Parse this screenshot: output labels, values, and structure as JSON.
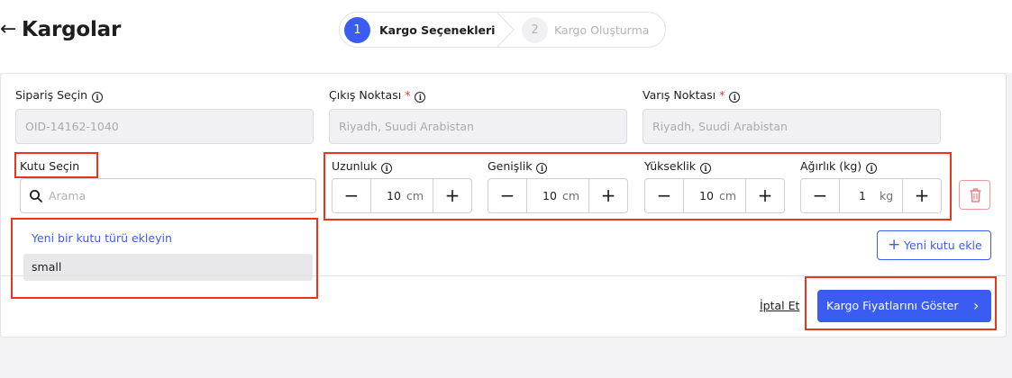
{
  "header": {
    "back_icon": "arrow-left-icon",
    "title": "Kargolar"
  },
  "steps": [
    {
      "number": "1",
      "label": "Kargo Seçenekleri",
      "active": true
    },
    {
      "number": "2",
      "label": "Kargo Oluşturma",
      "active": false
    }
  ],
  "form": {
    "order": {
      "label": "Sipariş Seçin",
      "value": "OID-14162-1040"
    },
    "origin": {
      "label": "Çıkış Noktası",
      "required": "*",
      "value": "Riyadh, Suudi Arabistan"
    },
    "destination": {
      "label": "Varış Noktası",
      "required": "*",
      "value": "Riyadh, Suudi Arabistan"
    },
    "box": {
      "label": "Kutu Seçin",
      "search_placeholder": "Arama",
      "dropdown": {
        "add_link": "Yeni bir kutu türü ekleyin",
        "options": [
          "small"
        ]
      }
    },
    "dimensions": [
      {
        "label": "Uzunluk",
        "value": "10",
        "unit": "cm"
      },
      {
        "label": "Genişlik",
        "value": "10",
        "unit": "cm"
      },
      {
        "label": "Yükseklik",
        "value": "10",
        "unit": "cm"
      },
      {
        "label": "Ağırlık (kg)",
        "value": "1",
        "unit": "kg"
      }
    ],
    "stepper_minus": "−",
    "stepper_plus": "+",
    "info_glyph": "i",
    "new_box_plus": "+",
    "new_box_button": "Yeni kutu ekle"
  },
  "footer": {
    "cancel": "İptal Et",
    "submit": "Kargo Fiyatlarını Göster",
    "submit_chevron": "›"
  },
  "colors": {
    "primary": "#3b5cf0",
    "highlight": "#e8351c",
    "danger": "#ef9a9a"
  }
}
